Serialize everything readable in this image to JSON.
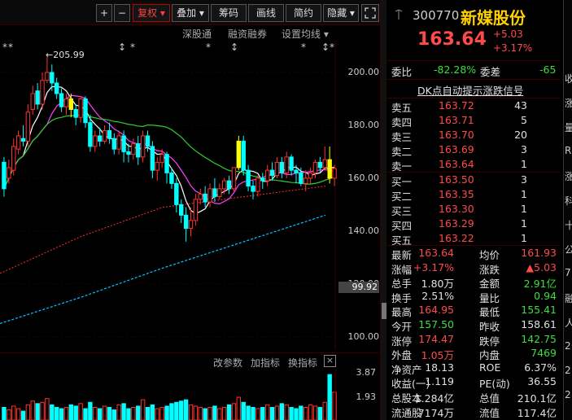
{
  "toolbar": {
    "plus": "+",
    "minus": "−",
    "restore": "复权 ▾",
    "overlay": "叠加 ▾",
    "chips": "筹码",
    "line_draw": "画线",
    "simple": "简约",
    "hide": "隐藏 ▾",
    "expand_icon": "expand-icon"
  },
  "subbar": {
    "stock_connect": "深股通",
    "margin": "融资融券",
    "ma_settings": "设置均线 ▾"
  },
  "chart": {
    "high_marker": "205.99",
    "current_price_tag": "99.92",
    "y_ticks": [
      "200.00",
      "180.00",
      "160.00",
      "140.00",
      "120.00",
      "100.00"
    ],
    "indicator_bar": {
      "modify": "改参数",
      "add": "加指标",
      "switch": "换指标",
      "close": "×"
    },
    "vol_ticks": [
      "3.87",
      "1.93"
    ],
    "colors": {
      "up": "#ff3030",
      "down": "#00ffff",
      "ma5": "#ffffff",
      "ma10": "#ff40ff",
      "ma20": "#30d030",
      "ma60": "#ff3030",
      "ma120": "#00c8ff",
      "highlight": "#ffff00"
    }
  },
  "chart_data": {
    "type": "candlestick",
    "ylim": [
      95,
      212
    ],
    "candles_low_to_high_note": "",
    "candles": [
      [
        166,
        156,
        168,
        153
      ],
      [
        160,
        164,
        167,
        158
      ],
      [
        163,
        172,
        175,
        161
      ],
      [
        171,
        176,
        178,
        169
      ],
      [
        175,
        174,
        180,
        172
      ],
      [
        174,
        185,
        188,
        172
      ],
      [
        186,
        192,
        195,
        184
      ],
      [
        193,
        188,
        196,
        186
      ],
      [
        188,
        197,
        200,
        186
      ],
      [
        197,
        200,
        206,
        196
      ],
      [
        200,
        196,
        203,
        193
      ],
      [
        196,
        192,
        198,
        190
      ],
      [
        192,
        187,
        194,
        185
      ],
      [
        187,
        190,
        192,
        184
      ],
      [
        190,
        186,
        192,
        183
      ],
      [
        186,
        183,
        188,
        180
      ],
      [
        183,
        190,
        191,
        181
      ],
      [
        190,
        181,
        191,
        179
      ],
      [
        181,
        172,
        184,
        170
      ],
      [
        172,
        176,
        178,
        170
      ],
      [
        176,
        174,
        179,
        172
      ],
      [
        174,
        178,
        180,
        173
      ],
      [
        178,
        175,
        181,
        173
      ],
      [
        175,
        171,
        177,
        169
      ],
      [
        171,
        176,
        178,
        169
      ],
      [
        176,
        170,
        178,
        166
      ],
      [
        170,
        169,
        173,
        166
      ],
      [
        169,
        173,
        175,
        167
      ],
      [
        173,
        168,
        176,
        165
      ],
      [
        168,
        176,
        178,
        166
      ],
      [
        176,
        172,
        178,
        170
      ],
      [
        172,
        163,
        174,
        160
      ],
      [
        163,
        166,
        168,
        159
      ],
      [
        166,
        169,
        171,
        164
      ],
      [
        169,
        162,
        170,
        158
      ],
      [
        162,
        158,
        164,
        156
      ],
      [
        158,
        150,
        160,
        147
      ],
      [
        150,
        146,
        152,
        143
      ],
      [
        146,
        141,
        149,
        136
      ],
      [
        141,
        144,
        149,
        138
      ],
      [
        144,
        152,
        154,
        142
      ],
      [
        152,
        154,
        156,
        150
      ],
      [
        154,
        151,
        157,
        149
      ],
      [
        151,
        156,
        158,
        149
      ],
      [
        156,
        153,
        160,
        151
      ],
      [
        153,
        156,
        158,
        152
      ],
      [
        156,
        159,
        160,
        154
      ],
      [
        159,
        156,
        161,
        154
      ],
      [
        156,
        164,
        164,
        155
      ],
      [
        164,
        174,
        176,
        163
      ],
      [
        174,
        163,
        176,
        161
      ],
      [
        163,
        157,
        165,
        155
      ],
      [
        157,
        155,
        159,
        152
      ],
      [
        155,
        160,
        161,
        153
      ],
      [
        160,
        159,
        162,
        156
      ],
      [
        159,
        163,
        165,
        157
      ],
      [
        163,
        161,
        166,
        159
      ],
      [
        161,
        166,
        168,
        160
      ],
      [
        166,
        162,
        168,
        160
      ],
      [
        162,
        168,
        170,
        160
      ],
      [
        168,
        163,
        169,
        161
      ],
      [
        163,
        162,
        165,
        158
      ],
      [
        162,
        158,
        164,
        157
      ],
      [
        158,
        160,
        163,
        155
      ],
      [
        160,
        162,
        164,
        158
      ],
      [
        162,
        166,
        167,
        160
      ],
      [
        166,
        164,
        168,
        162
      ],
      [
        164,
        167,
        172,
        163
      ],
      [
        167,
        160,
        172,
        158
      ],
      [
        160,
        163.64,
        165,
        157
      ]
    ],
    "volume": [
      1.0,
      0.8,
      1.1,
      0.9,
      0.7,
      1.2,
      1.5,
      1.3,
      1.4,
      1.7,
      1.2,
      1.0,
      0.9,
      1.0,
      1.2,
      1.1,
      1.3,
      0.9,
      1.4,
      1.0,
      0.9,
      1.1,
      1.0,
      0.8,
      1.2,
      1.3,
      0.9,
      1.0,
      1.1,
      1.6,
      1.0,
      1.2,
      0.9,
      1.0,
      1.1,
      1.3,
      1.4,
      1.5,
      1.6,
      1.2,
      1.1,
      1.0,
      0.9,
      1.0,
      1.1,
      0.9,
      1.0,
      1.2,
      1.3,
      1.8,
      1.4,
      1.1,
      1.0,
      0.9,
      1.0,
      1.2,
      1.0,
      1.1,
      1.3,
      1.2,
      1.0,
      0.9,
      1.1,
      1.0,
      1.2,
      1.1,
      1.0,
      1.4,
      3.6,
      2.2
    ]
  },
  "quote": {
    "code": "300770",
    "name": "新媒股份",
    "price": "163.64",
    "change": "+5.03",
    "change_pct": "+3.17%",
    "webi_label": "委比",
    "webi": "-82.28%",
    "wecha_label": "委差",
    "wecha": "-65",
    "dk_signal": "DK点自动提示涨跌信号",
    "asks": [
      {
        "label": "卖五",
        "price": "163.72",
        "vol": "43"
      },
      {
        "label": "卖四",
        "price": "163.71",
        "vol": "5"
      },
      {
        "label": "卖三",
        "price": "163.70",
        "vol": "20"
      },
      {
        "label": "卖二",
        "price": "163.69",
        "vol": "3"
      },
      {
        "label": "卖一",
        "price": "163.64",
        "vol": "1"
      }
    ],
    "bids": [
      {
        "label": "买一",
        "price": "163.50",
        "vol": "3"
      },
      {
        "label": "买二",
        "price": "163.35",
        "vol": "1"
      },
      {
        "label": "买三",
        "price": "163.30",
        "vol": "1"
      },
      {
        "label": "买四",
        "price": "163.29",
        "vol": "1"
      },
      {
        "label": "买五",
        "price": "163.22",
        "vol": "1"
      }
    ],
    "stats": [
      {
        "l1": "最新",
        "v1": "163.64",
        "c1": "red",
        "l2": "均价",
        "v2": "161.93",
        "c2": "red"
      },
      {
        "l1": "涨幅",
        "v1": "+3.17%",
        "c1": "red",
        "l2": "涨跌",
        "v2": "▲5.03",
        "c2": "red"
      },
      {
        "l1": "总手",
        "v1": "1.80万",
        "c1": "white",
        "l2": "金额",
        "v2": "2.91亿",
        "c2": "green"
      },
      {
        "l1": "换手",
        "v1": "2.51%",
        "c1": "white",
        "l2": "量比",
        "v2": "0.94",
        "c2": "green"
      },
      {
        "l1": "最高",
        "v1": "164.95",
        "c1": "red",
        "l2": "最低",
        "v2": "155.41",
        "c2": "green"
      },
      {
        "l1": "今开",
        "v1": "157.50",
        "c1": "green",
        "l2": "昨收",
        "v2": "158.61",
        "c2": "white"
      },
      {
        "l1": "涨停",
        "v1": "174.47",
        "c1": "red",
        "l2": "跌停",
        "v2": "142.75",
        "c2": "green"
      },
      {
        "l1": "外盘",
        "v1": "1.05万",
        "c1": "red",
        "l2": "内盘",
        "v2": "7469",
        "c2": "green"
      },
      {
        "l1": "净资产",
        "v1": "18.13",
        "c1": "white",
        "l2": "ROE",
        "v2": "6.37%",
        "c2": "white"
      },
      {
        "l1": "收益(一)",
        "v1": "1.119",
        "c1": "white",
        "l2": "PE(动)",
        "v2": "36.55",
        "c2": "white"
      },
      {
        "l1": "总股本",
        "v1": "1.284亿",
        "c1": "white",
        "l2": "总值",
        "v2": "210.1亿",
        "c2": "white"
      },
      {
        "l1": "流通股",
        "v1": "7174万",
        "c1": "white",
        "l2": "流值",
        "v2": "117.4亿",
        "c2": "white"
      }
    ]
  },
  "edge_text": [
    "收",
    "涨",
    "量",
    "R",
    "涨",
    "科",
    "十",
    "公",
    "7",
    "融",
    "人",
    "2",
    "2",
    "2"
  ]
}
